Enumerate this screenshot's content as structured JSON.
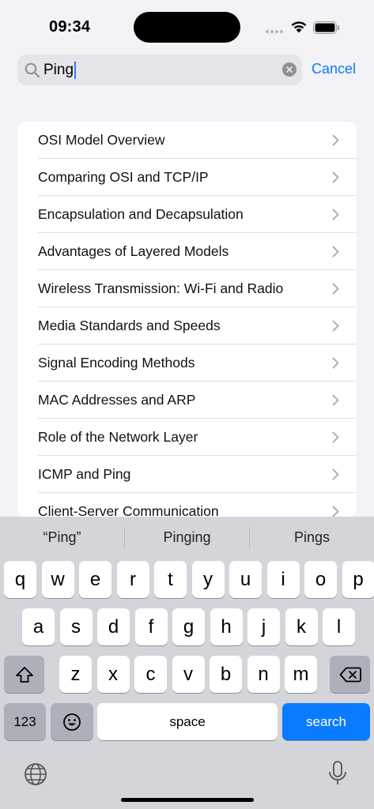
{
  "status_bar": {
    "time": "09:34"
  },
  "search": {
    "query": "Ping",
    "cancel_label": "Cancel"
  },
  "results": [
    {
      "label": "OSI Model Overview"
    },
    {
      "label": "Comparing OSI and TCP/IP"
    },
    {
      "label": "Encapsulation and Decapsulation"
    },
    {
      "label": "Advantages of Layered Models"
    },
    {
      "label": "Wireless Transmission: Wi-Fi and Radio"
    },
    {
      "label": "Media Standards and Speeds"
    },
    {
      "label": "Signal Encoding Methods"
    },
    {
      "label": "MAC Addresses and ARP"
    },
    {
      "label": "Role of the Network Layer"
    },
    {
      "label": "ICMP and Ping"
    },
    {
      "label": "Client-Server Communication"
    }
  ],
  "keyboard": {
    "suggestions": [
      "“Ping”",
      "Pinging",
      "Pings"
    ],
    "row1": [
      "q",
      "w",
      "e",
      "r",
      "t",
      "y",
      "u",
      "i",
      "o",
      "p"
    ],
    "row2": [
      "a",
      "s",
      "d",
      "f",
      "g",
      "h",
      "j",
      "k",
      "l"
    ],
    "row3": [
      "z",
      "x",
      "c",
      "v",
      "b",
      "n",
      "m"
    ],
    "numbers_label": "123",
    "space_label": "space",
    "search_label": "search",
    "accent_color": "#0a7aff"
  }
}
